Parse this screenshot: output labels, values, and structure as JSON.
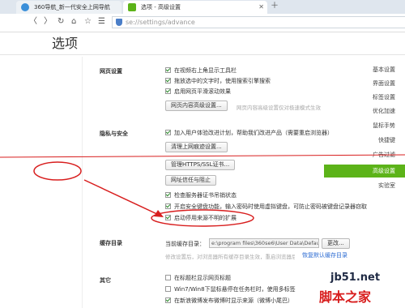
{
  "tabs": [
    {
      "label": "360导航_新一代安全上网导航",
      "active": false
    },
    {
      "label": "选项 - 高级设置",
      "active": true
    }
  ],
  "address": {
    "url": "se://settings/advance"
  },
  "page_title": "选项",
  "sidebar": {
    "items": [
      {
        "label": "基本设置"
      },
      {
        "label": "界面设置"
      },
      {
        "label": "标签设置"
      },
      {
        "label": "优化加速"
      },
      {
        "label": "鼠标手势"
      },
      {
        "label": "快捷键"
      },
      {
        "label": "广告过滤"
      },
      {
        "label": "高级设置",
        "active": true
      },
      {
        "label": "实验室"
      }
    ]
  },
  "web_settings": {
    "title": "网页设置",
    "options": [
      {
        "label": "在视频右上角显示工具栏",
        "checked": true
      },
      {
        "label": "拖放选中的文字时，使用搜索引擎搜索",
        "checked": true
      },
      {
        "label": "启用网页平滑滚动效果",
        "checked": true
      }
    ],
    "content_button": "网页内容高级设置...",
    "content_hint": "网页内容高级设置仅对极速模式生效"
  },
  "privacy": {
    "title": "隐私与安全",
    "join_label": "加入用户体验改进计划，帮助我们改进产品（需要重启浏览器）",
    "join_checked": true,
    "clear_button": "清理上网痕迹设置...",
    "cert_button": "管理HTTPS/SSL证书...",
    "trust_button": "网址信任与阻止",
    "options": [
      {
        "label": "检查服务器证书吊销状态",
        "checked": true
      },
      {
        "label": "开启安全键盘功能，输入密码时使用虚拟键盘，可防止密码被键盘记录器窃取",
        "checked": true
      },
      {
        "label": "启动停用来源不明的扩展",
        "checked": true
      }
    ]
  },
  "cache": {
    "title": "缓存目录",
    "label": "当前缓存目录：",
    "path": "e:\\program files\\360se6\\User Data\\Default",
    "change_button": "更改...",
    "note": "修改设置后，对浏览器所有缓存目录生效，重启浏览器后生效。",
    "restore_link": "恢复默认缓存目录"
  },
  "other": {
    "title": "其它",
    "options": [
      {
        "label": "在标题栏显示网页标题",
        "checked": false
      },
      {
        "label": "Win7/Win8下鼠标悬停在任务栏时，使用多标签",
        "checked": false
      },
      {
        "label": "在新浪微博发布微博时显示来源（微博小尾巴）",
        "checked": true
      }
    ]
  },
  "watermark": {
    "line1": "jb51.net",
    "line2": "脚本之家"
  },
  "colors": {
    "accent_green": "#5cb319",
    "annotation_red": "#d81e1e",
    "link_blue": "#2a6ad2"
  }
}
